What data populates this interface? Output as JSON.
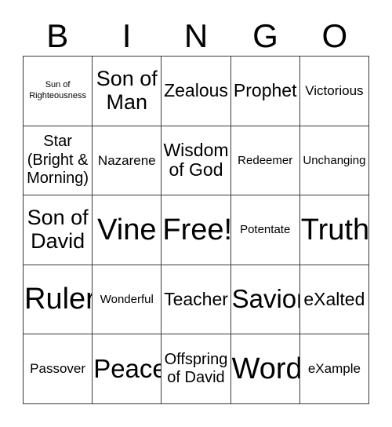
{
  "card": {
    "title": "BINGO",
    "header_letters": [
      "B",
      "I",
      "N",
      "G",
      "O"
    ],
    "columns": 5,
    "rows": 5,
    "border_color": "#3a3a3a",
    "text_color": "#000000",
    "background_color": "#ffffff",
    "cells": [
      [
        {
          "text": "Sun of\nRighteousness",
          "size": "fs-xs"
        },
        {
          "text": "Son of\nMan",
          "size": "fs-2xl"
        },
        {
          "text": "Zealous",
          "size": "fs-xl"
        },
        {
          "text": "Prophet",
          "size": "fs-xl"
        },
        {
          "text": "Victorious",
          "size": "fs-md"
        }
      ],
      [
        {
          "text": "Star\n(Bright &\nMorning)",
          "size": "fs-lg"
        },
        {
          "text": "Nazarene",
          "size": "fs-md"
        },
        {
          "text": "Wisdom\nof God",
          "size": "fs-xl"
        },
        {
          "text": "Redeemer",
          "size": "fs-sm"
        },
        {
          "text": "Unchanging",
          "size": "fs-sm"
        }
      ],
      [
        {
          "text": "Son of\nDavid",
          "size": "fs-2xl"
        },
        {
          "text": "Vine",
          "size": "fs-4xl"
        },
        {
          "text": "Free!",
          "size": "fs-4xl"
        },
        {
          "text": "Potentate",
          "size": "fs-sm"
        },
        {
          "text": "Truth",
          "size": "fs-4xl"
        }
      ],
      [
        {
          "text": "Ruler",
          "size": "fs-4xl"
        },
        {
          "text": "Wonderful",
          "size": "fs-sm"
        },
        {
          "text": "Teacher",
          "size": "fs-xl"
        },
        {
          "text": "Savior",
          "size": "fs-3xl"
        },
        {
          "text": "eXalted",
          "size": "fs-xl"
        }
      ],
      [
        {
          "text": "Passover",
          "size": "fs-md"
        },
        {
          "text": "Peace",
          "size": "fs-3xl"
        },
        {
          "text": "Offspring\nof David",
          "size": "fs-lg"
        },
        {
          "text": "Word",
          "size": "fs-4xl"
        },
        {
          "text": "eXample",
          "size": "fs-md"
        }
      ]
    ]
  }
}
